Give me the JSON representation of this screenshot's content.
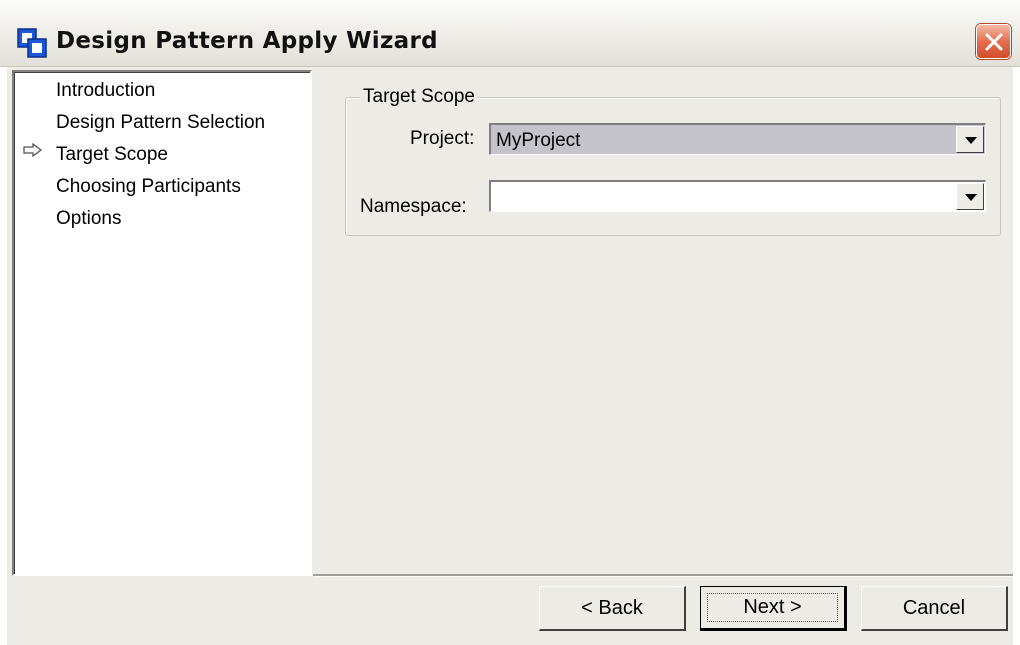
{
  "window": {
    "title": "Design Pattern Apply Wizard",
    "app_icon": "overlapping-squares-icon",
    "close_icon": "close-x-icon",
    "accent_color": "#1c57d8",
    "close_color": "#d9552f"
  },
  "steps": {
    "current_marker_icon": "arrow-right-icon",
    "items": [
      {
        "label": "Introduction"
      },
      {
        "label": "Design Pattern Selection"
      },
      {
        "label": "Target Scope",
        "current": true
      },
      {
        "label": "Choosing Participants"
      },
      {
        "label": "Options"
      }
    ]
  },
  "target_scope": {
    "group_title": "Target Scope",
    "project_label": "Project:",
    "project_value": "MyProject",
    "namespace_label": "Namespace:",
    "namespace_value": ""
  },
  "buttons": {
    "back": "< Back",
    "next": "Next >",
    "cancel": "Cancel"
  }
}
